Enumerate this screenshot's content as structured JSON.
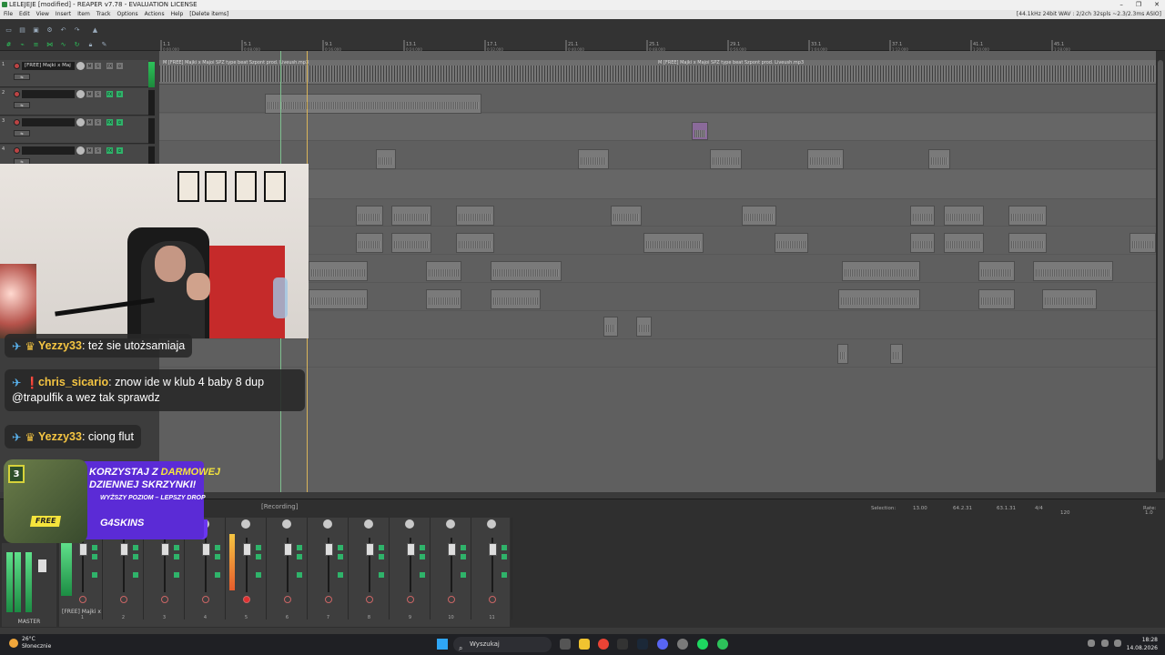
{
  "window": {
    "title": "LELEJEJE [modified] - REAPER v7.78 - EVALUATION LICENSE",
    "buttons": [
      "–",
      "❐",
      "✕"
    ]
  },
  "menu": {
    "items": [
      "File",
      "Edit",
      "View",
      "Insert",
      "Item",
      "Track",
      "Options",
      "Actions",
      "Help",
      "[Delete items]"
    ],
    "status": "[44.1kHz 24bit WAV : 2/2ch 32spls ~2.3/2.3ms ASIO]"
  },
  "ruler": {
    "marks": [
      "1.1",
      "5.1",
      "9.1",
      "13.1",
      "17.1",
      "21.1",
      "25.1",
      "29.1",
      "33.1",
      "37.1",
      "41.1",
      "45.1"
    ],
    "times": [
      "0:00.000",
      "0:08.000",
      "0:16.000",
      "0:24.000",
      "0:32.000",
      "0:40.000",
      "0:48.000",
      "0:56.000",
      "1:04.000",
      "1:12.000",
      "1:20.000",
      "1:28.000"
    ]
  },
  "tracks": [
    {
      "num": "1",
      "name": "[FREE] Majki x Maj"
    },
    {
      "num": "2",
      "name": ""
    },
    {
      "num": "3",
      "name": ""
    },
    {
      "num": "4",
      "name": ""
    }
  ],
  "arrange": {
    "beat_label_left": "M [FREE] Majki x Majoi SPZ type beat Szpont prod. Liveush.mp3",
    "beat_label_right": "M [FREE] Majki x Majoi SPZ type beat Szpont prod. Liveush.mp3"
  },
  "chat": [
    {
      "user": "Yezzy33",
      "msg": "też sie utożsamiaja",
      "color": "#f5c542"
    },
    {
      "user": "chris_sicario",
      "msg": "znow ide w klub 4 baby 8 dup",
      "msg2": "@trapulfik a wez tak sprawdz",
      "color": "#f5c542"
    },
    {
      "user": "Yezzy33",
      "msg": "ciong flut",
      "color": "#f5c542"
    }
  ],
  "promo": {
    "level": "3",
    "line1_a": "KORZYSTAJ Z ",
    "line1_b": "DARMOWEJ",
    "line2": "DZIENNEJ SKRZYNKI!",
    "line3": "WYŻSZY POZIOM – LEPSZY DROP",
    "free": "FREE",
    "brand": "G4SKINS"
  },
  "mixer": {
    "recording_label": "[Recording]",
    "master_label": "MASTER",
    "track_name": "[FREE] Majki x",
    "strip_numbers": [
      "1",
      "2",
      "3",
      "4",
      "5",
      "6",
      "7",
      "8",
      "9",
      "10",
      "11"
    ]
  },
  "transport": {
    "selection_label": "Selection:",
    "sel_start": "13.00",
    "sel_end": "64.2.31",
    "sel_len": "63.1.31",
    "time_sig": "4/4",
    "bpm": "120",
    "rate_label": "Rate:",
    "rate": "1.0"
  },
  "taskbar": {
    "temp": "26°C",
    "weather": "Słonecznie",
    "search": "Wyszukaj",
    "time": "18:28",
    "date": "14.08.2026"
  },
  "colors": {
    "accent_green": "#2dc25a",
    "record_red": "#cc3b3b",
    "promo_purple": "#5b2bd6"
  }
}
